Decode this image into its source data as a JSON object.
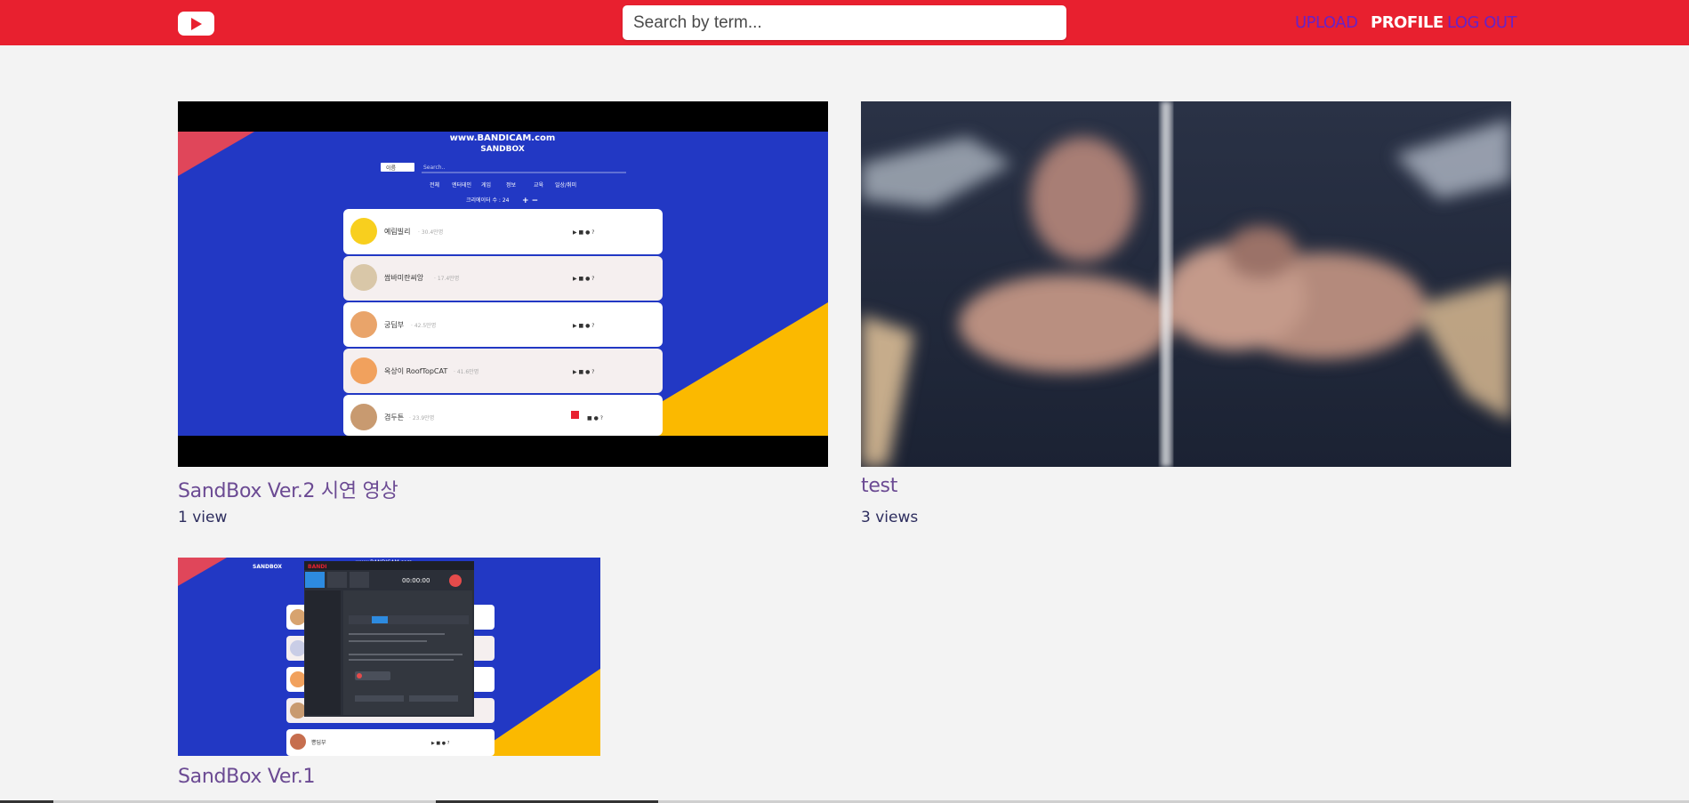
{
  "header": {
    "logo_icon": "youtube-play-icon",
    "search_placeholder": "Search by term...",
    "nav": {
      "upload": "UPLOAD",
      "profile": "PROFILE",
      "logout": "LOG OUT"
    }
  },
  "colors": {
    "header_bg": "#e8202f",
    "nav_link": "#6a22c4",
    "title": "#6b4a93",
    "views": "#2d2d5e",
    "sandbox_blue": "#2238c4",
    "sandbox_yellow": "#fbb900"
  },
  "videos": [
    {
      "title": "SandBox Ver.2 시연 영상",
      "views": "1 view",
      "thumb": {
        "banner": "www.BANDICAM.com",
        "subtitle": "SANDBOX",
        "select_label": "이름",
        "search_placeholder": "Search..",
        "categories": [
          "전체",
          "엔터테인",
          "게임",
          "정보",
          "교육",
          "일상/취미"
        ],
        "creator_count": "크리에이터 수 : 24",
        "rows": [
          {
            "name": "예림빌리",
            "sub": "· 30.4만명"
          },
          {
            "name": "쌈바미란씨앙",
            "sub": "· 17.4만명"
          },
          {
            "name": "궁딥부",
            "sub": "· 42.5만명"
          },
          {
            "name": "옥상이 RoofTopCAT",
            "sub": "· 41.6만명"
          },
          {
            "name": "겸두튼",
            "sub": "· 23.9만명"
          }
        ]
      }
    },
    {
      "title": "test",
      "views": "3 views"
    },
    {
      "title": "SandBox Ver.1",
      "thumb": {
        "banner": "www.BANDICAM.com",
        "brand": "SANDBOX",
        "timer": "00:00:00",
        "row_name": "쁭딥부"
      }
    }
  ]
}
